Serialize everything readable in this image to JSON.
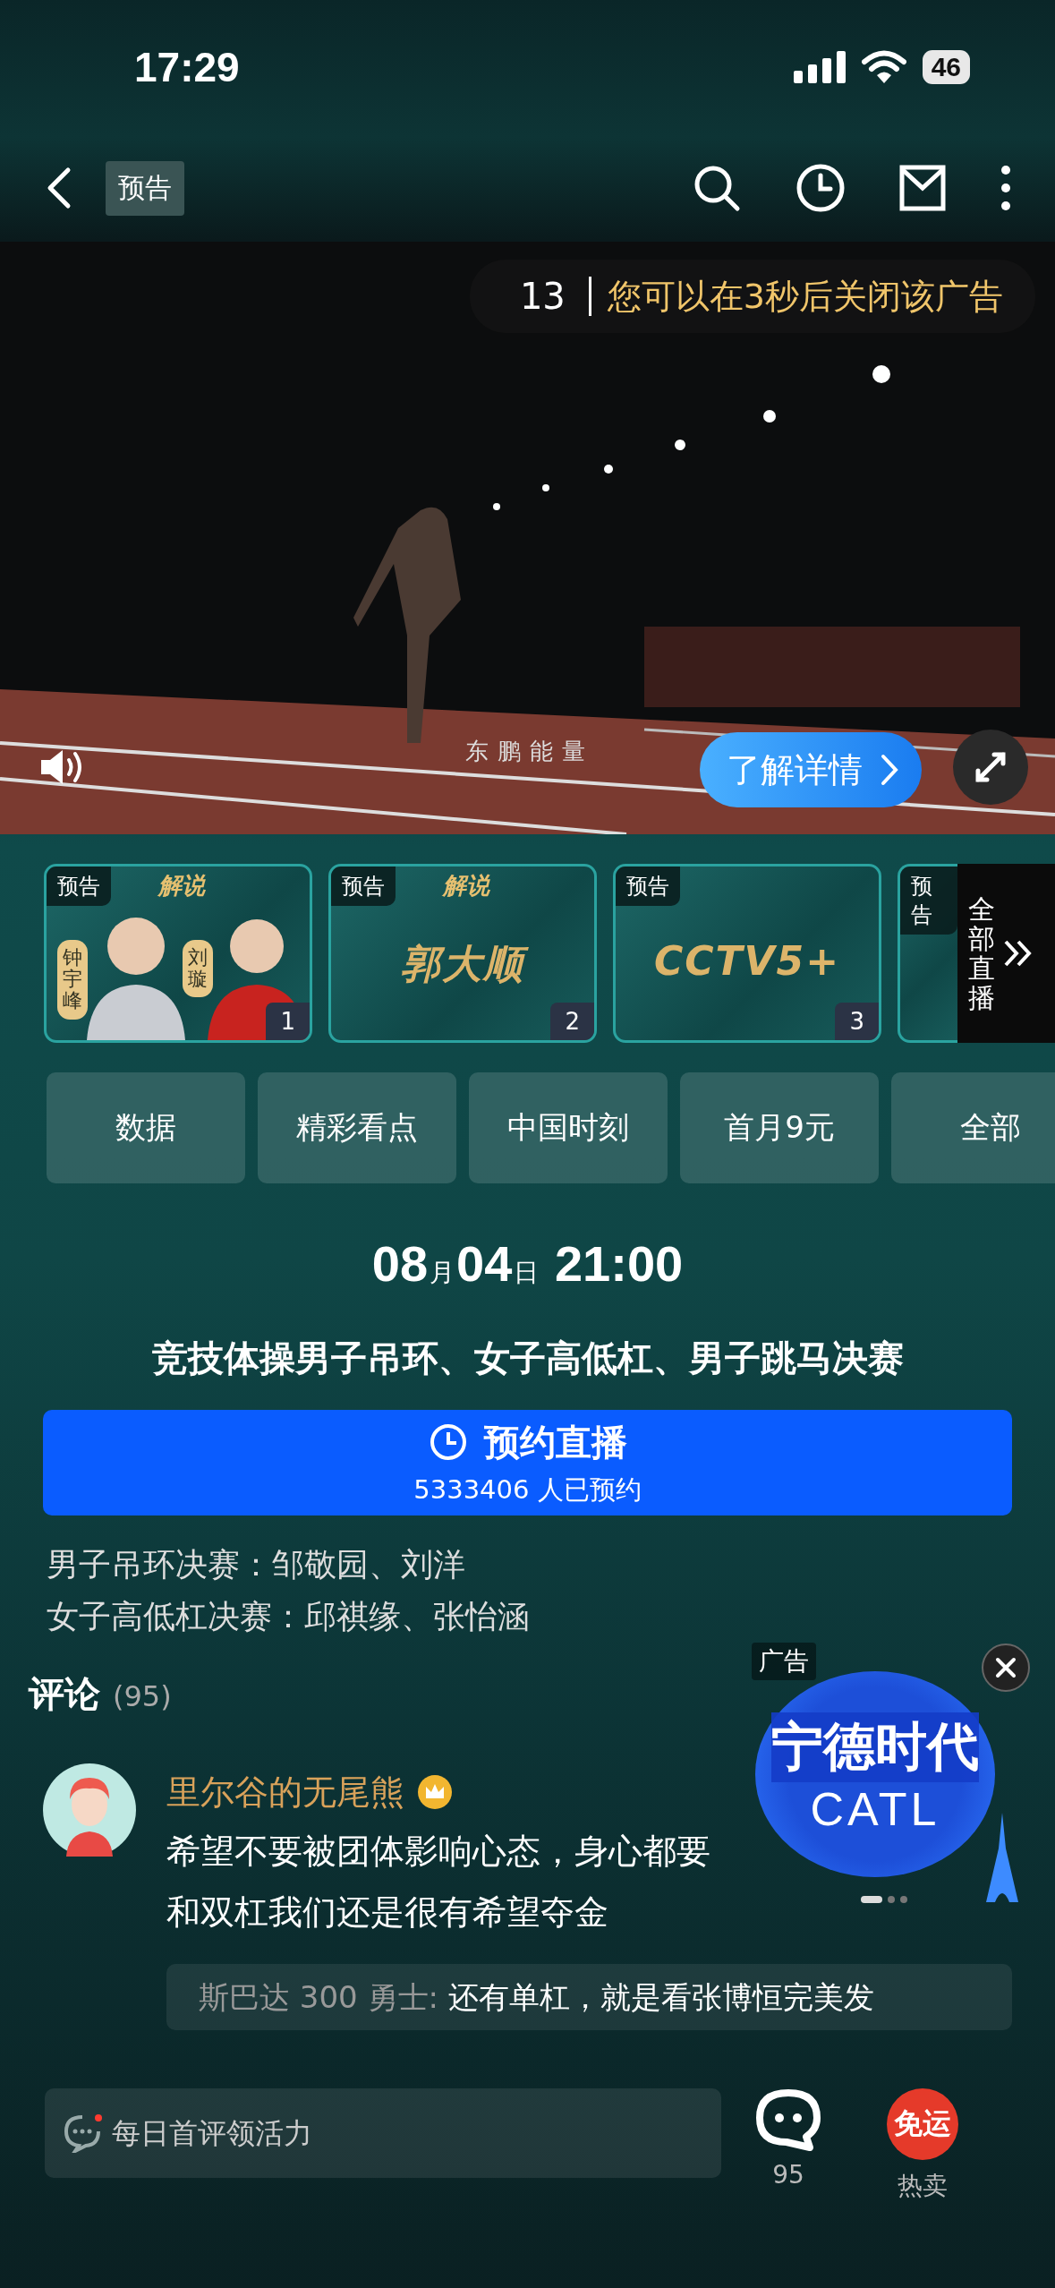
{
  "status_bar": {
    "time": "17:29",
    "battery": "46"
  },
  "nav": {
    "tag": "预告"
  },
  "video_ad": {
    "countdown": "13",
    "notice": "您可以在3秒后关闭该广告",
    "brand": "东鹏能量",
    "cta": "了解详情"
  },
  "channels": [
    {
      "kind": "hosts",
      "tag": "预告",
      "label": "解说",
      "hosts": [
        "钟宇峰",
        "刘璇"
      ],
      "number": "1"
    },
    {
      "kind": "title",
      "tag": "预告",
      "label": "解说",
      "title": "郭大顺",
      "number": "2"
    },
    {
      "kind": "title",
      "tag": "预告",
      "title": "CCTV5+",
      "number": "3"
    },
    {
      "kind": "partial",
      "tag": "预告"
    }
  ],
  "all_live": "全部直播",
  "tabs": [
    "数据",
    "精彩看点",
    "中国时刻",
    "首月9元",
    "全部"
  ],
  "event": {
    "month": "08",
    "month_unit": "月",
    "day": "04",
    "day_unit": "日",
    "time": "21:00",
    "title": "竞技体操男子吊环、女子高低杠、男子跳马决赛",
    "reserve": {
      "label": "预约直播",
      "count": "5333406 人已预约"
    },
    "details": [
      "男子吊环决赛：邹敬园、刘洋",
      "女子高低杠决赛：邱祺缘、张怡涵"
    ]
  },
  "comments_header": {
    "title": "评论",
    "count": "(95)"
  },
  "floating_ad": {
    "label": "广告",
    "brand": "宁德时代",
    "brand_en": "CATL",
    "dots": [
      {
        "selected": true
      },
      {
        "selected": false
      },
      {
        "selected": false
      }
    ]
  },
  "comments": [
    {
      "user": "里尔谷的无尾熊",
      "vip": true,
      "lines": [
        "希望不要被团体影响心态，身心都要",
        "和双杠我们还是很有希望夺金"
      ],
      "reply": {
        "user": "斯巴达 300 勇士:",
        "text": "还有单杠，就是看张博恒完美发"
      }
    }
  ],
  "bottom_bar": {
    "placeholder": "每日首评领活力",
    "comment_count": "95",
    "promo_badge": "免运",
    "promo_label": "热卖"
  }
}
